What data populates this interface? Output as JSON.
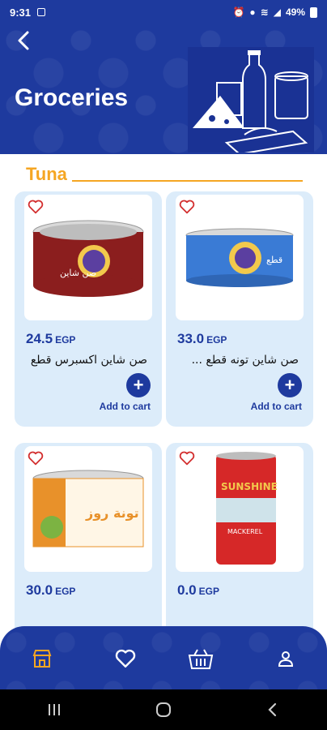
{
  "status_bar": {
    "time": "9:31",
    "battery": "49%"
  },
  "header": {
    "title": "Groceries"
  },
  "section": {
    "title": "Tuna"
  },
  "products": [
    {
      "price": "24.5",
      "currency": "EGP",
      "name": "صن شاين اكسبرس قطع ...",
      "add_label": "Add to cart",
      "add_icon": "+"
    },
    {
      "price": "33.0",
      "currency": "EGP",
      "name": "صن شاين تونه قطع ...",
      "add_label": "Add to cart",
      "add_icon": "+"
    },
    {
      "price": "30.0",
      "currency": "EGP",
      "name": "",
      "add_label": "",
      "add_icon": ""
    },
    {
      "price": "0.0",
      "currency": "EGP",
      "name": "",
      "add_label": "",
      "add_icon": ""
    }
  ],
  "product_images": [
    {
      "brand_text": "صن شاين",
      "color": "#8b1e1e"
    },
    {
      "brand_text": "قطع",
      "color": "#3a7bd5"
    },
    {
      "brand_text": "تونة روز",
      "color": "#e8912a"
    },
    {
      "brand_text": "SUNSHINE",
      "color": "#d62828",
      "subtext": "MACKEREL"
    }
  ],
  "icons": {
    "back": "back-arrow-icon",
    "heart": "heart-icon",
    "store": "store-icon",
    "favorites": "heart-icon",
    "basket": "basket-icon",
    "profile": "user-icon"
  },
  "colors": {
    "primary": "#1e3a9e",
    "accent": "#f5a623",
    "card_bg": "#dcecfa",
    "active_nav": "#f5a623"
  }
}
